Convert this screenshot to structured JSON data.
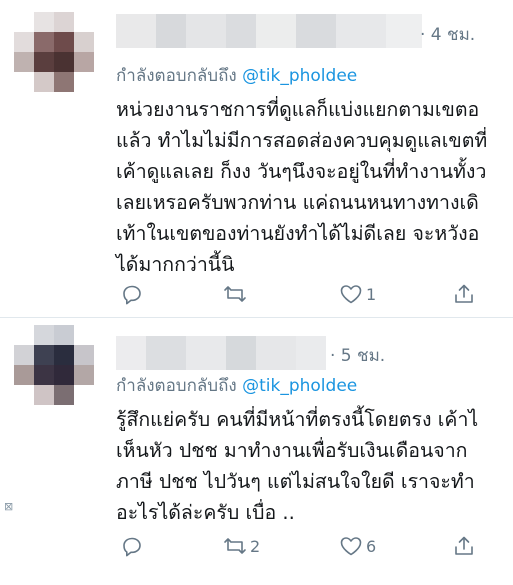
{
  "tweets": [
    {
      "time": "· 4 ชม.",
      "reply_prefix": "กำลังตอบกลับถึง",
      "reply_handle": "@tik_pholdee",
      "lines": [
        "หน่วยงานราชการที่ดูแลก็แบ่งแยกตามเขตอ",
        "แล้ว ทำไมไม่มีการสอดส่องควบคุมดูแลเขตที่",
        "เค้าดูแลเลย ก็งง วันๆนึงจะอยู่ในที่ทำงานทั้งว",
        "เลยเหรอครับพวกท่าน แค่ถนนหนทางทางเดิ",
        "เท้าในเขตของท่านยังทำได้ไม่ดีเลย จะหวังอ",
        "ได้มากกว่านี้นิ"
      ],
      "actions": {
        "reply_count": "",
        "retweet_count": "",
        "like_count": "1"
      }
    },
    {
      "time": "· 5 ชม.",
      "reply_prefix": "กำลังตอบกลับถึง",
      "reply_handle": "@tik_pholdee",
      "lines": [
        "รู้สึกแย่ครับ คนที่มีหน้าที่ตรงนี้โดยตรง เค้าไ",
        "เห็นหัว ปชช มาทำงานเพื่อรับเงินเดือนจาก",
        "ภาษี ปชช ไปวันๆ แต่ไม่สนใจใยดี เราจะทำ",
        "อะไรได้ล่ะครับ เบื่อ .."
      ],
      "actions": {
        "reply_count": "",
        "retweet_count": "2",
        "like_count": "6"
      }
    }
  ],
  "icons": {
    "reply": "reply-icon",
    "retweet": "retweet-icon",
    "like": "heart-icon",
    "share": "share-icon"
  },
  "colors": {
    "text": "#14171a",
    "secondary": "#657786",
    "link": "#1b95e0",
    "divider": "#e1e8ed"
  },
  "misc": {
    "corner_mark": "⊠"
  }
}
